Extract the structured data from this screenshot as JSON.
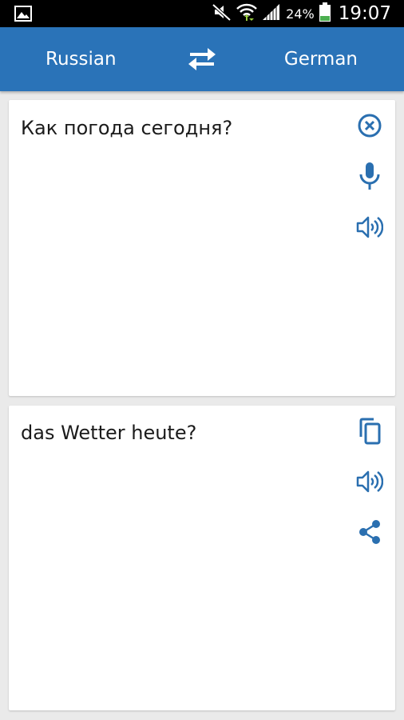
{
  "status_bar": {
    "battery_percent": "24%",
    "time": "19:07",
    "icons": [
      "image-icon",
      "mute-icon",
      "wifi-icon",
      "signal-icon",
      "battery-icon"
    ]
  },
  "toolbar": {
    "source_language": "Russian",
    "target_language": "German",
    "swap_icon": "swap-icon",
    "background_color": "#2a73b8"
  },
  "source_card": {
    "text": "Как погода сегодня?",
    "actions": [
      "clear-icon",
      "microphone-icon",
      "speaker-icon"
    ]
  },
  "target_card": {
    "text": "das Wetter heute?",
    "actions": [
      "copy-icon",
      "speaker-icon",
      "share-icon"
    ]
  },
  "colors": {
    "accent": "#2a73b8",
    "icon": "#2a6fb0",
    "background": "#eaeaea"
  }
}
